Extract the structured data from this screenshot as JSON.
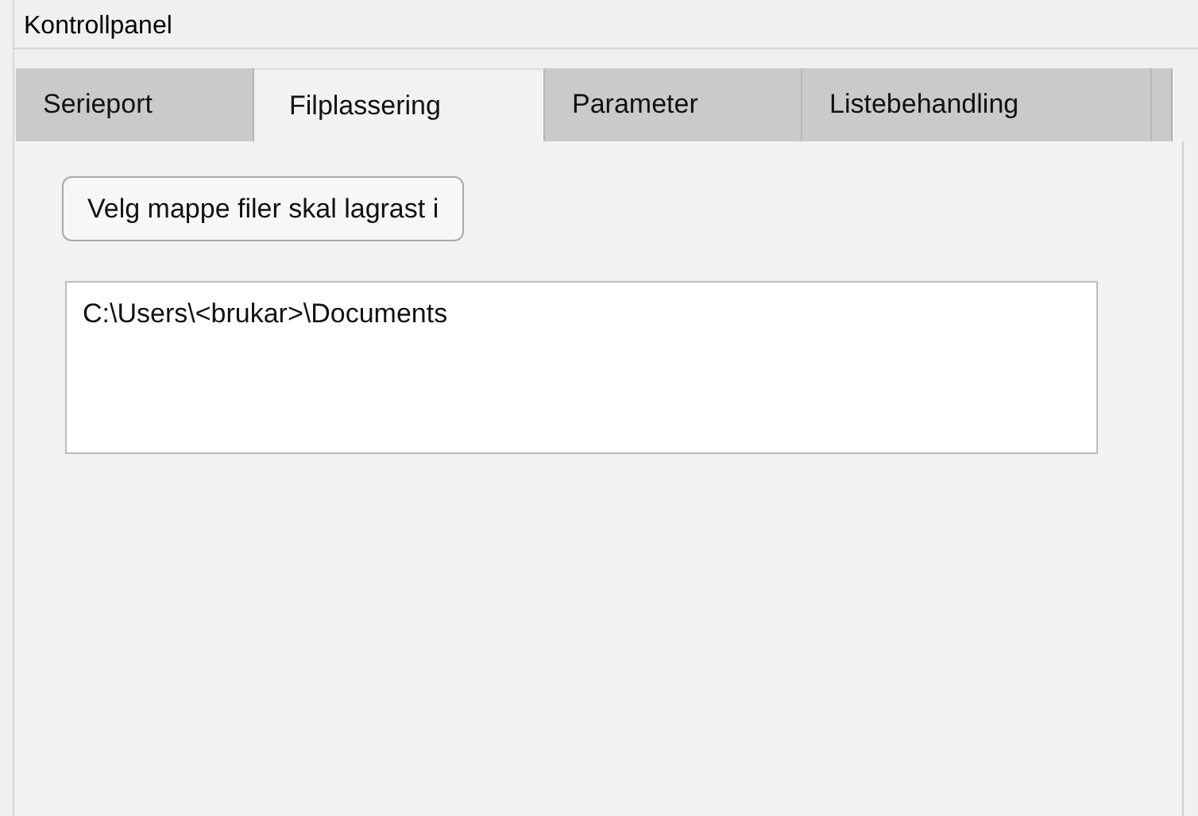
{
  "panel": {
    "title": "Kontrollpanel"
  },
  "tabs": [
    {
      "label": "Serieport",
      "selected": false
    },
    {
      "label": "Filplassering",
      "selected": true
    },
    {
      "label": "Parameter",
      "selected": false
    },
    {
      "label": "Listebehandling",
      "selected": false
    }
  ],
  "folder_button": {
    "label": "Velg mappe filer skal lagrast i"
  },
  "path_field": {
    "value": "C:\\Users\\<brukar>\\Documents"
  }
}
